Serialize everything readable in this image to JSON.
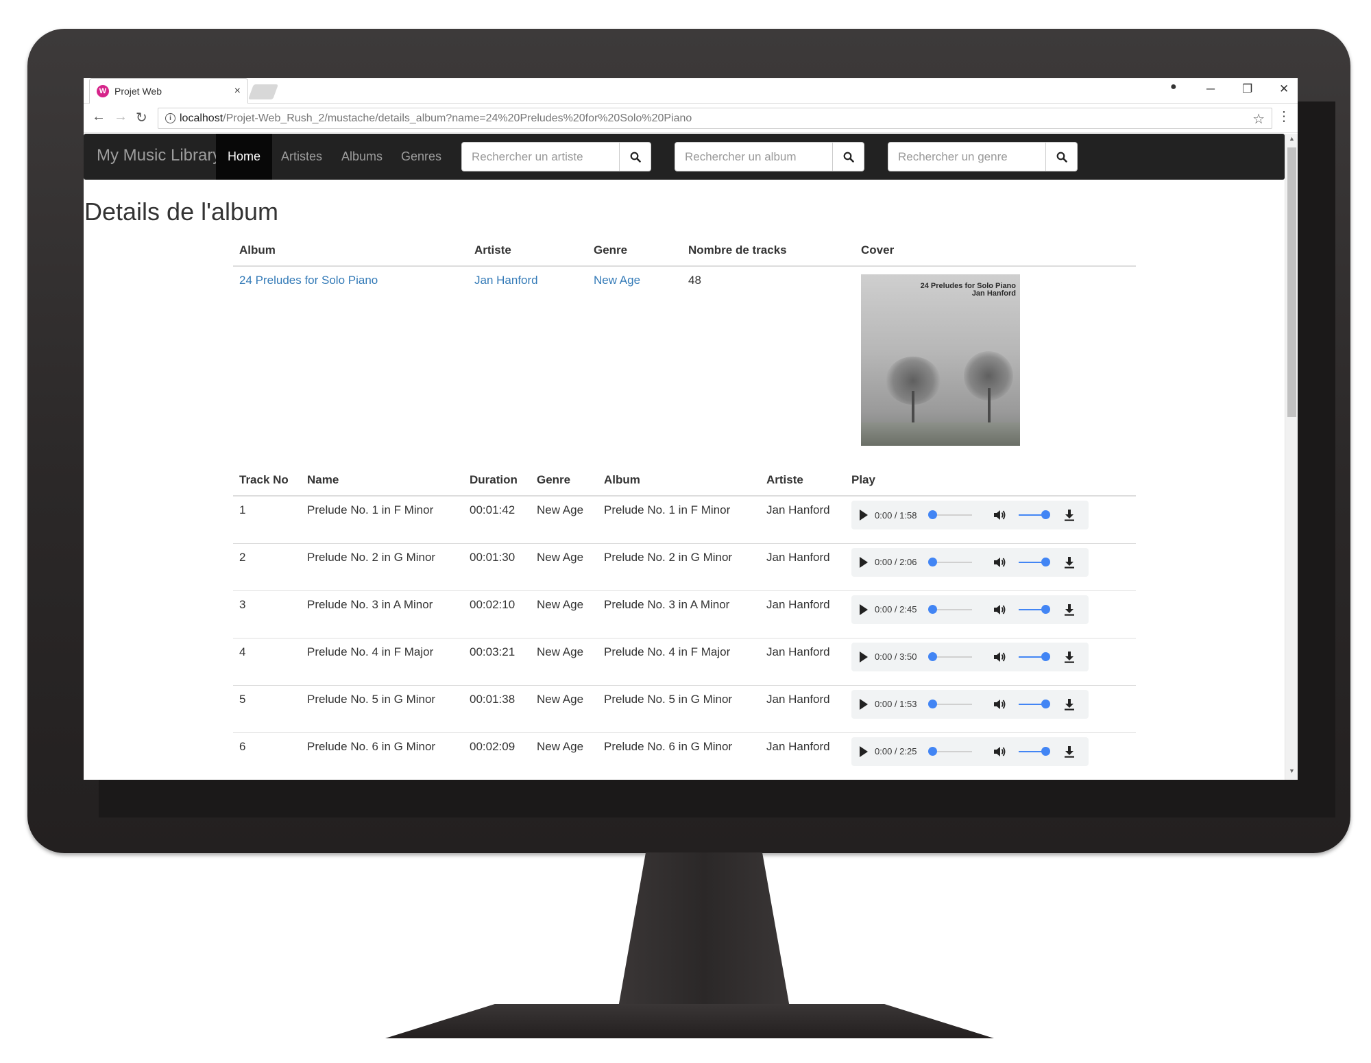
{
  "browser": {
    "tab_title": "Projet Web",
    "favicon_letter": "W",
    "close_glyph": "×",
    "url_host": "localhost",
    "url_path": "/Projet-Web_Rush_2/mustache/details_album?name=24%20Preludes%20for%20Solo%20Piano",
    "back_glyph": "←",
    "forward_glyph": "→",
    "reload_glyph": "↻",
    "star_glyph": "☆",
    "menu_glyph": "⋮",
    "minimize_glyph": "─",
    "restore_glyph": "❐",
    "window_close_glyph": "✕",
    "account_glyph": "●",
    "scroll_up_glyph": "▲",
    "scroll_down_glyph": "▼"
  },
  "navbar": {
    "brand": "My Music Library",
    "links": [
      "Home",
      "Artistes",
      "Albums",
      "Genres"
    ],
    "active_link": "Home",
    "search_artist_placeholder": "Rechercher un artiste",
    "search_album_placeholder": "Rechercher un album",
    "search_genre_placeholder": "Rechercher un genre"
  },
  "page": {
    "title": "Details de l'album"
  },
  "album_table": {
    "headers": [
      "Album",
      "Artiste",
      "Genre",
      "Nombre de tracks",
      "Cover"
    ],
    "row": {
      "album": "24 Preludes for Solo Piano",
      "artist": "Jan Hanford",
      "genre": "New Age",
      "tracks": "48",
      "cover_text_line1": "24 Preludes for Solo Piano",
      "cover_text_line2": "Jan Hanford"
    }
  },
  "tracks_table": {
    "headers": [
      "Track No",
      "Name",
      "Duration",
      "Genre",
      "Album",
      "Artiste",
      "Play"
    ],
    "rows": [
      {
        "no": "1",
        "name": "Prelude No. 1 in F Minor",
        "duration": "00:01:42",
        "genre": "New Age",
        "album": "Prelude No. 1 in F Minor",
        "artist": "Jan Hanford",
        "player_time": "0:00 / 1:58"
      },
      {
        "no": "2",
        "name": "Prelude No. 2 in G Minor",
        "duration": "00:01:30",
        "genre": "New Age",
        "album": "Prelude No. 2 in G Minor",
        "artist": "Jan Hanford",
        "player_time": "0:00 / 2:06"
      },
      {
        "no": "3",
        "name": "Prelude No. 3 in A Minor",
        "duration": "00:02:10",
        "genre": "New Age",
        "album": "Prelude No. 3 in A Minor",
        "artist": "Jan Hanford",
        "player_time": "0:00 / 2:45"
      },
      {
        "no": "4",
        "name": "Prelude No. 4 in F Major",
        "duration": "00:03:21",
        "genre": "New Age",
        "album": "Prelude No. 4 in F Major",
        "artist": "Jan Hanford",
        "player_time": "0:00 / 3:50"
      },
      {
        "no": "5",
        "name": "Prelude No. 5 in G Minor",
        "duration": "00:01:38",
        "genre": "New Age",
        "album": "Prelude No. 5 in G Minor",
        "artist": "Jan Hanford",
        "player_time": "0:00 / 1:53"
      },
      {
        "no": "6",
        "name": "Prelude No. 6 in G Minor",
        "duration": "00:02:09",
        "genre": "New Age",
        "album": "Prelude No. 6 in G Minor",
        "artist": "Jan Hanford",
        "player_time": "0:00 / 2:25"
      }
    ],
    "player_progress_fraction": 0,
    "player_volume_fraction": 1
  },
  "colors": {
    "navbar_bg": "#222222",
    "link": "#337ab7",
    "player_accent": "#4285f4",
    "favicon": "#d6248a"
  },
  "icons": {
    "search": "search-icon",
    "play": "play-icon",
    "volume": "volume-icon",
    "download": "download-icon"
  }
}
